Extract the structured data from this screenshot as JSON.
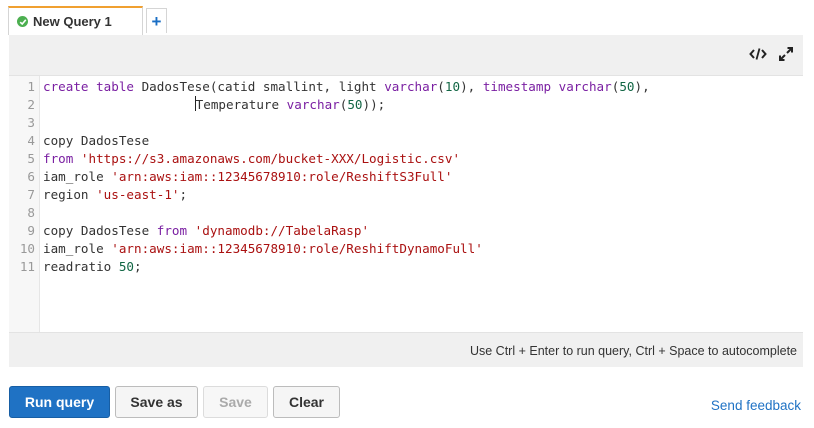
{
  "tabs": [
    {
      "label": "New Query 1",
      "status_icon": "check-icon",
      "status_color": "#4caf50",
      "active": true
    }
  ],
  "add_tab_label": "+",
  "editor": {
    "tools": [
      "code-format-icon",
      "expand-icon"
    ],
    "lines": [
      [
        {
          "t": "create table ",
          "c": "kw"
        },
        {
          "t": "DadosTese(catid smallint, light ",
          "c": "txt"
        },
        {
          "t": "varchar",
          "c": "kw"
        },
        {
          "t": "(",
          "c": "txt"
        },
        {
          "t": "10",
          "c": "num"
        },
        {
          "t": "), ",
          "c": "txt"
        },
        {
          "t": "timestamp varchar",
          "c": "kw"
        },
        {
          "t": "(",
          "c": "txt"
        },
        {
          "t": "50",
          "c": "num"
        },
        {
          "t": "),",
          "c": "txt"
        }
      ],
      [
        {
          "t": "                    ",
          "c": "txt"
        },
        {
          "t": "",
          "c": "cursor"
        },
        {
          "t": "Temperature ",
          "c": "txt"
        },
        {
          "t": "varchar",
          "c": "kw"
        },
        {
          "t": "(",
          "c": "txt"
        },
        {
          "t": "50",
          "c": "num"
        },
        {
          "t": "));",
          "c": "txt"
        }
      ],
      [],
      [
        {
          "t": "copy DadosTese",
          "c": "txt"
        }
      ],
      [
        {
          "t": "from ",
          "c": "kw"
        },
        {
          "t": "'https://s3.amazonaws.com/bucket-XXX/Logistic.csv'",
          "c": "str"
        }
      ],
      [
        {
          "t": "iam_role ",
          "c": "txt"
        },
        {
          "t": "'arn:aws:iam::12345678910:role/ReshiftS3Full'",
          "c": "str"
        }
      ],
      [
        {
          "t": "region ",
          "c": "txt"
        },
        {
          "t": "'us-east-1'",
          "c": "str"
        },
        {
          "t": ";",
          "c": "txt"
        }
      ],
      [],
      [
        {
          "t": "copy DadosTese ",
          "c": "txt"
        },
        {
          "t": "from ",
          "c": "kw"
        },
        {
          "t": "'dynamodb://TabelaRasp'",
          "c": "str"
        }
      ],
      [
        {
          "t": "iam_role ",
          "c": "txt"
        },
        {
          "t": "'arn:aws:iam::12345678910:role/ReshiftDynamoFull'",
          "c": "str"
        }
      ],
      [
        {
          "t": "readratio ",
          "c": "txt"
        },
        {
          "t": "50",
          "c": "num"
        },
        {
          "t": ";",
          "c": "txt"
        }
      ]
    ],
    "hint": "Use Ctrl + Enter to run query, Ctrl + Space to autocomplete"
  },
  "buttons": {
    "run": "Run query",
    "save_as": "Save as",
    "save": "Save",
    "clear": "Clear"
  },
  "feedback_link": "Send feedback",
  "colors": {
    "accent": "#1f72c4",
    "tab_highlight": "#f0a030"
  }
}
